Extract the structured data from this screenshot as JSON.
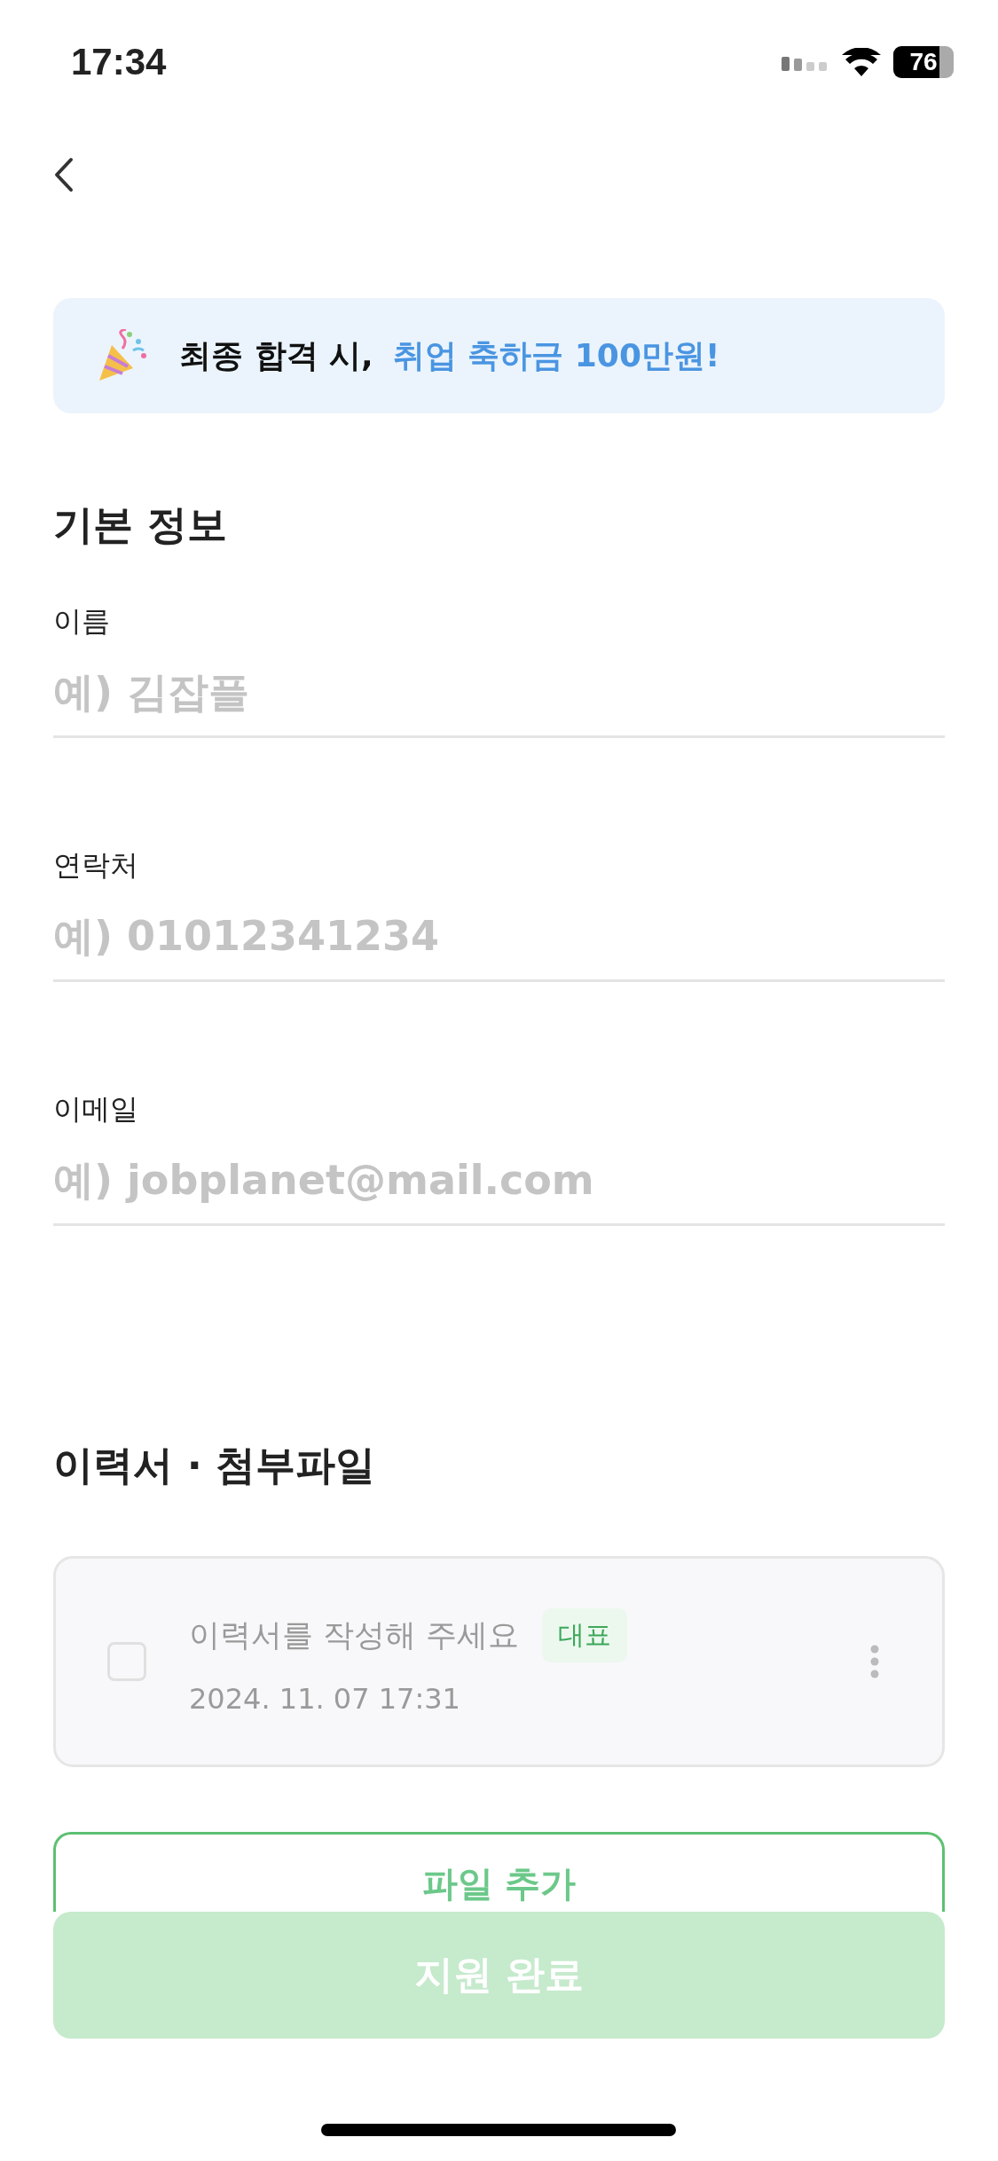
{
  "status_bar": {
    "time": "17:34",
    "battery": "76"
  },
  "banner": {
    "text": "최종 합격 시,",
    "highlight": "취업 축하금 100만원!"
  },
  "basic_info": {
    "title": "기본 정보",
    "fields": [
      {
        "label": "이름",
        "placeholder": "예) 김잡플"
      },
      {
        "label": "연락처",
        "placeholder": "예) 01012341234"
      },
      {
        "label": "이메일",
        "placeholder": "예) jobplanet@mail.com"
      }
    ]
  },
  "attachments": {
    "title": "이력서 · 첨부파일",
    "files": [
      {
        "name": "이력서를 작성해 주세요",
        "badge": "대표",
        "date": "2024. 11. 07  17:31",
        "checked": false
      }
    ],
    "add_button": "파일 추가"
  },
  "submit_button": {
    "label": "지원 완료",
    "disabled": true
  }
}
